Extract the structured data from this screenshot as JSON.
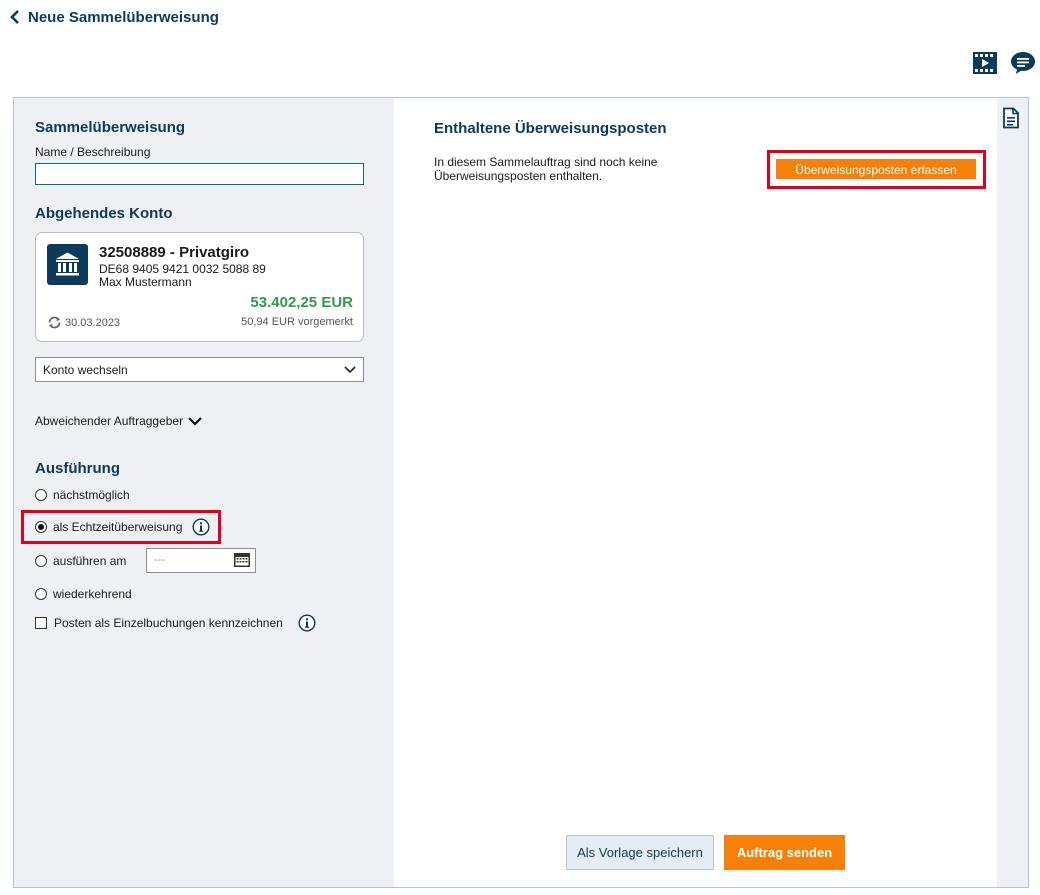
{
  "header": {
    "back_title": "Neue Sammelüberweisung",
    "icons": [
      "video-icon",
      "chat-icon"
    ]
  },
  "left": {
    "title": "Sammelüberweisung",
    "name_label": "Name / Beschreibung",
    "name_value": "",
    "account_section_title": "Abgehendes Konto",
    "account": {
      "name": "32508889 - Privatgiro",
      "iban": "DE68 9405 9421 0032 5088 89",
      "owner": "Max Mustermann",
      "balance": "53.402,25 EUR",
      "date": "30.03.2023",
      "pending": "50,94 EUR vorgemerkt",
      "balance_color": "#2c9b4b"
    },
    "switch_account_label": "Konto wechseln",
    "different_orderer_label": "Abweichender Auftraggeber",
    "execution_title": "Ausführung",
    "options": {
      "asap": "nächstmöglich",
      "instant": "als Echtzeitüberweisung",
      "on_date": "ausführen am",
      "recurring": "wiederkehrend",
      "selected": "instant"
    },
    "date_placeholder": "---",
    "single_bookings_label": "Posten als Einzelbuchungen kennzeichnen"
  },
  "right": {
    "title": "Enthaltene Überweisungsposten",
    "empty_message": "In diesem Sammelauftrag sind noch keine Überweisungsposten enthalten.",
    "add_item_button": "Überweisungsposten erfassen",
    "save_template_button": "Als Vorlage speichern",
    "send_button": "Auftrag senden"
  },
  "colors": {
    "accent_orange": "#f7800a",
    "brand_blue": "#0c3a5b",
    "highlight_red": "#e3001b"
  }
}
